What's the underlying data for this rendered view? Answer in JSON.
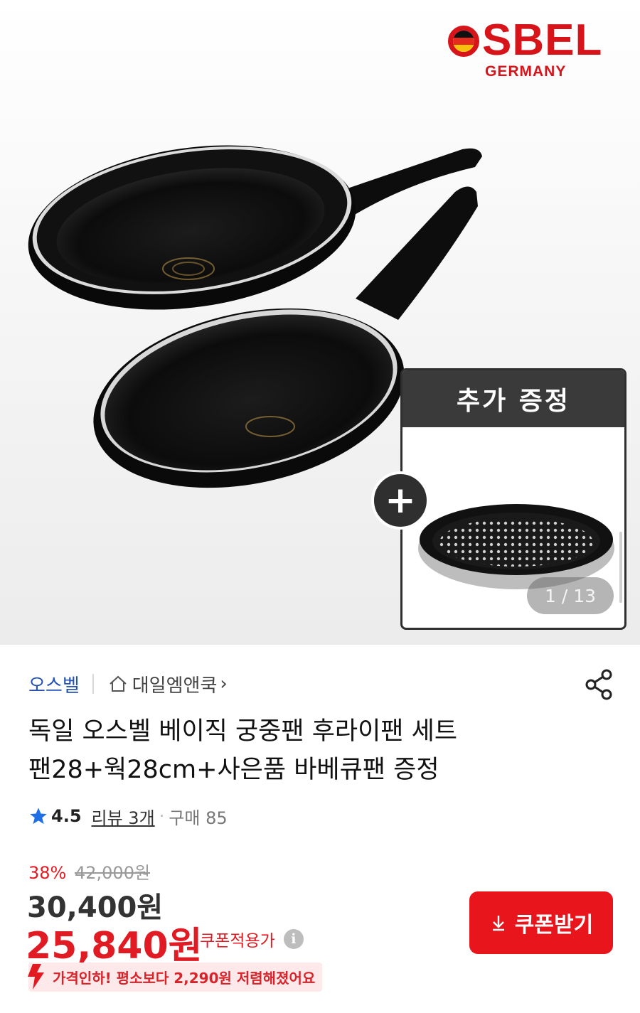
{
  "hero": {
    "logo": {
      "main": "SBEL",
      "sub": "GERMANY"
    },
    "gift_label": "추가 증정",
    "plus_symbol": "+",
    "image_counter": "1 / 13"
  },
  "product": {
    "brand": "오스벨",
    "store": "대일엠앤쿡",
    "store_chevron": "›",
    "title_line1": "독일 오스벨 베이직 궁중팬 후라이팬 세트",
    "title_line2": "팬28+웍28cm+사은품 바베큐팬 증정",
    "rating": "4.5",
    "review_label": "리뷰 3개",
    "dot": "·",
    "purchase_label": "구매 85"
  },
  "price": {
    "discount_pct": "38%",
    "original": "42,000원",
    "sale": "30,400원",
    "coupon_price": "25,840원",
    "coupon_note": "쿠폰적용가",
    "info_symbol": "i",
    "coupon_button": "쿠폰받기",
    "pricedrop_text": "가격인하! 평소보다 2,290원 저렴해졌어요"
  },
  "colors": {
    "brand_red": "#e8151d",
    "link_blue": "#2350b5",
    "star_blue": "#1f6fe5"
  },
  "icons": [
    "home-icon",
    "share-icon",
    "star-icon",
    "info-icon",
    "download-icon",
    "price-down-arrow-icon"
  ]
}
